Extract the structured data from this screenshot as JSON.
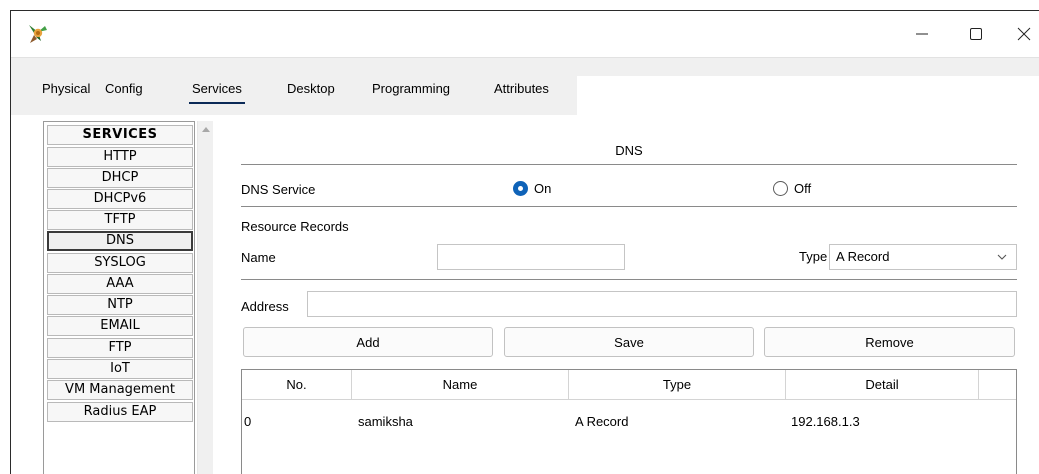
{
  "window": {
    "controls": {
      "minimize": "minimize-icon",
      "maximize": "maximize-icon",
      "close": "close-icon"
    }
  },
  "tabs": [
    {
      "label": "Physical",
      "active": false
    },
    {
      "label": "Config",
      "active": false
    },
    {
      "label": "Services",
      "active": true
    },
    {
      "label": "Desktop",
      "active": false
    },
    {
      "label": "Programming",
      "active": false
    },
    {
      "label": "Attributes",
      "active": false
    }
  ],
  "sidebar": {
    "header": "SERVICES",
    "items": [
      "HTTP",
      "DHCP",
      "DHCPv6",
      "TFTP",
      "DNS",
      "SYSLOG",
      "AAA",
      "NTP",
      "EMAIL",
      "FTP",
      "IoT",
      "VM Management",
      "Radius EAP"
    ],
    "selected": "DNS"
  },
  "dns": {
    "title": "DNS",
    "service_label": "DNS Service",
    "on_label": "On",
    "off_label": "Off",
    "service_state": "On",
    "resource_records_label": "Resource Records",
    "name_label": "Name",
    "name_value": "",
    "type_label": "Type",
    "type_value": "A Record",
    "address_label": "Address",
    "address_value": "",
    "buttons": {
      "add": "Add",
      "save": "Save",
      "remove": "Remove"
    },
    "table": {
      "columns": [
        "No.",
        "Name",
        "Type",
        "Detail"
      ],
      "rows": [
        {
          "no": "0",
          "name": "samiksha",
          "type": "A Record",
          "detail": "192.168.1.3"
        }
      ]
    }
  },
  "colors": {
    "accent": "#0f63b8",
    "tab_underline": "#0b2a57",
    "tabstrip_bg": "#f0f0f0"
  }
}
